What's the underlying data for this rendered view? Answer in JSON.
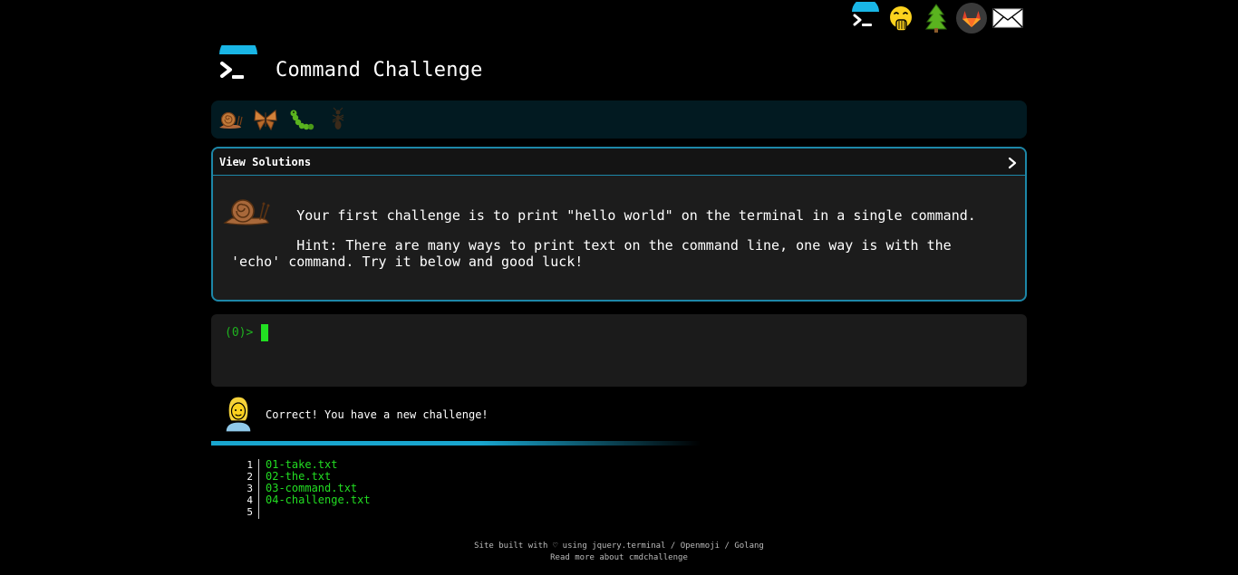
{
  "page": {
    "title": "Command Challenge"
  },
  "top_icons": [
    {
      "icon": "terminal-icon"
    },
    {
      "icon": "face-with-hand-over-mouth-icon"
    },
    {
      "icon": "tree-icon"
    },
    {
      "icon": "gitlab-icon"
    },
    {
      "icon": "envelope-icon"
    }
  ],
  "levels": [
    {
      "icon": "snail-icon"
    },
    {
      "icon": "butterfly-icon"
    },
    {
      "icon": "caterpillar-icon"
    },
    {
      "icon": "ant-icon"
    }
  ],
  "challenge": {
    "view_solutions_label": "View Solutions",
    "description": "Your first challenge is to print \"hello world\" on the terminal in a single command.",
    "hint": "Hint: There are many ways to print text on the command line, one way is with the 'echo' command. Try it below and good luck!"
  },
  "terminal": {
    "prompt": "(0)>"
  },
  "feedback": {
    "message": "Correct! You have a new challenge!"
  },
  "progress": {
    "fraction": 0.4
  },
  "files": [
    {
      "line": "1",
      "name": "01-take.txt"
    },
    {
      "line": "2",
      "name": "02-the.txt"
    },
    {
      "line": "3",
      "name": "03-command.txt"
    },
    {
      "line": "4",
      "name": "04-challenge.txt"
    },
    {
      "line": "5",
      "name": ""
    }
  ],
  "footer": {
    "line1": "Site built with ♡ using jquery.terminal / Openmoji / Golang",
    "line2": "Read more about cmdchallenge"
  },
  "colors": {
    "accent": "#1d87a8",
    "prompt_green": "#1fb31f",
    "file_green": "#22dd22",
    "level_bar_bg": "#021a21",
    "panel_bg": "#1c1c1c"
  }
}
